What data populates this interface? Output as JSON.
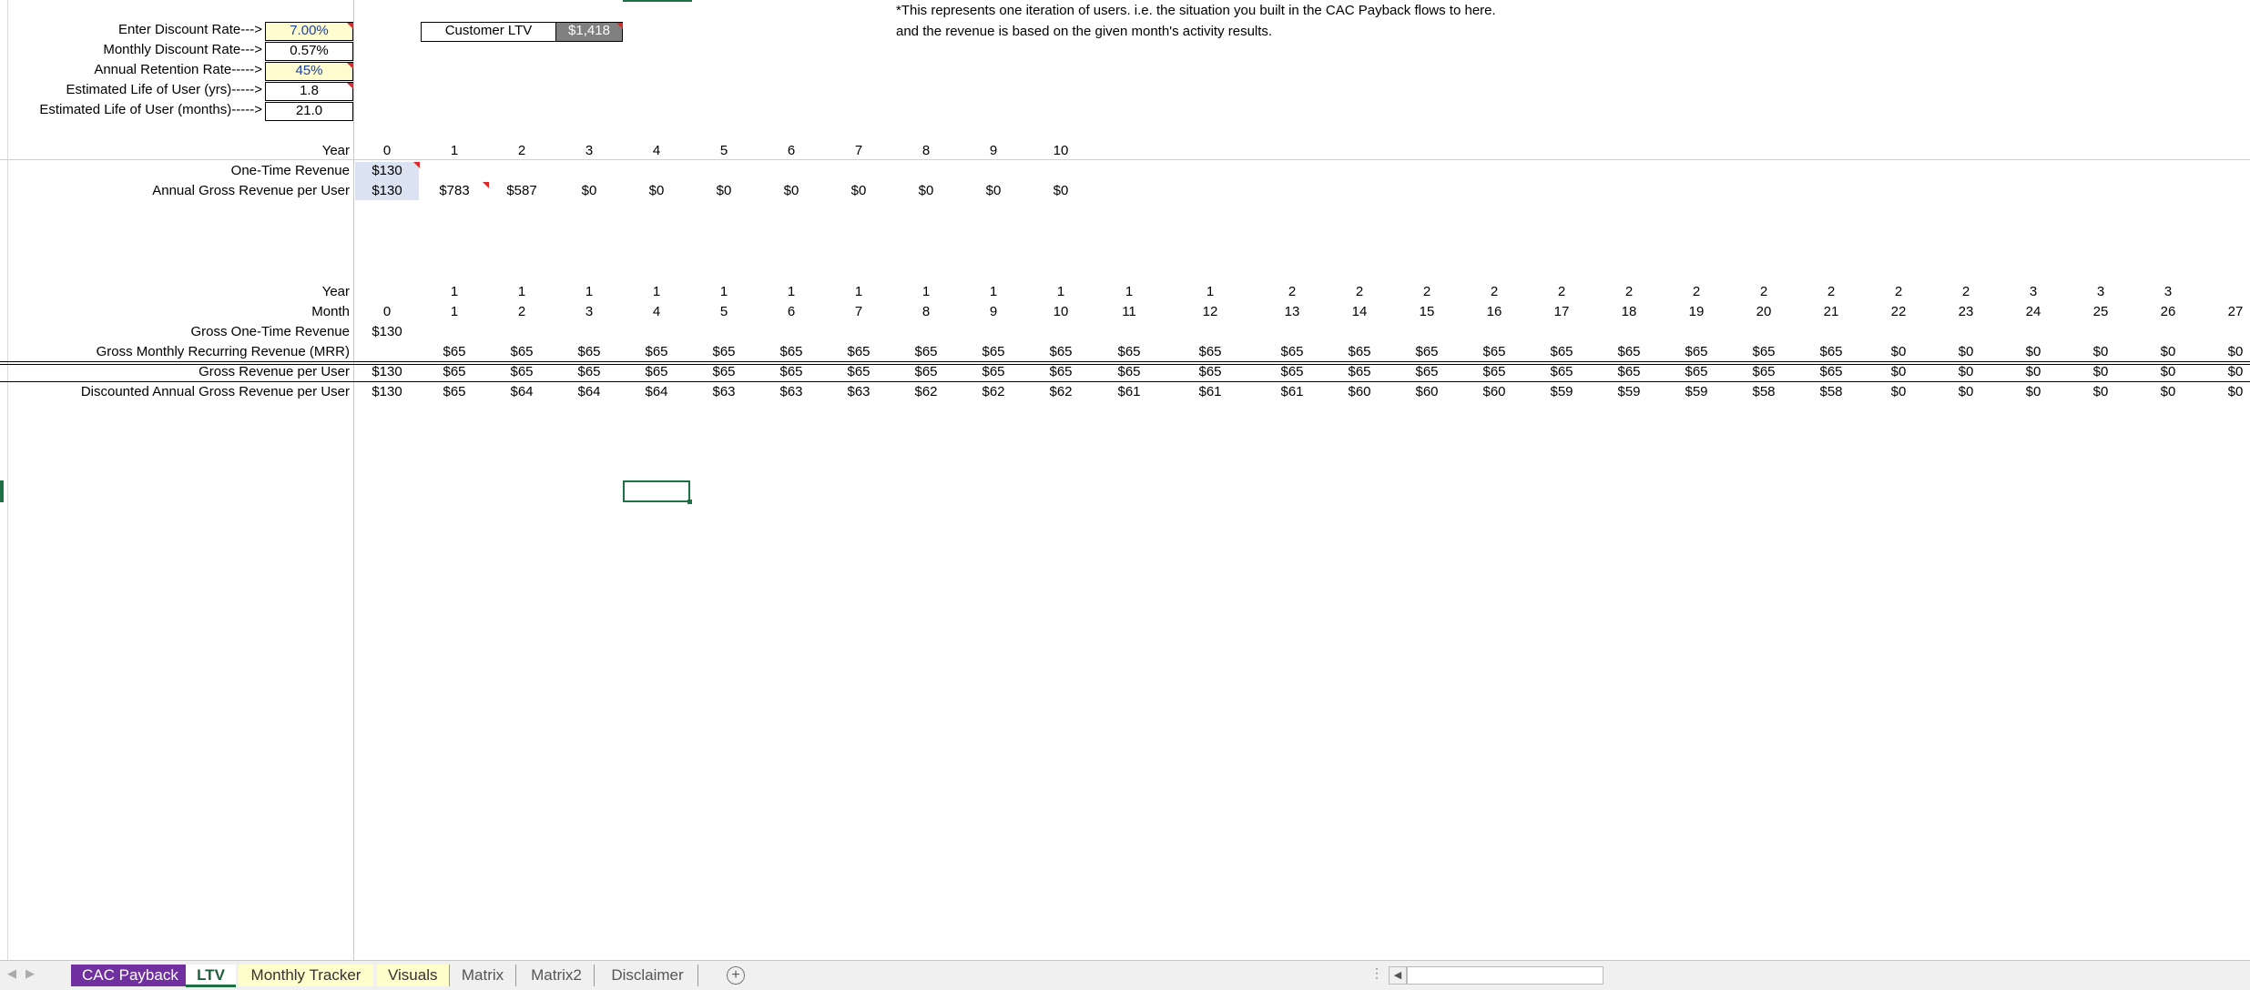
{
  "inputs": [
    {
      "label": "Enter Discount Rate--->",
      "value": "7.00%",
      "style": "yellow"
    },
    {
      "label": "Monthly Discount Rate--->",
      "value": "0.57%",
      "style": "plain"
    },
    {
      "label": "Annual Retention Rate----->",
      "value": "45%",
      "style": "yellow"
    },
    {
      "label": "Estimated Life of User (yrs)----->",
      "value": "1.8",
      "style": "plain"
    },
    {
      "label": "Estimated Life of User (months)----->",
      "value": "21.0",
      "style": "plain"
    }
  ],
  "ltv": {
    "label": "Customer LTV",
    "value": "$1,418"
  },
  "note": {
    "line1": "*This represents one iteration of users. i.e. the situation you built in the CAC Payback flows to here.",
    "line2": "and the revenue is based on the given month's activity results."
  },
  "annual": {
    "year_label": "Year",
    "years": [
      "0",
      "1",
      "2",
      "3",
      "4",
      "5",
      "6",
      "7",
      "8",
      "9",
      "10"
    ],
    "rows": [
      {
        "label": "One-Time Revenue",
        "values": [
          "$130"
        ]
      },
      {
        "label": "Annual Gross Revenue per User",
        "values": [
          "$130",
          "$783",
          "$587",
          "$0",
          "$0",
          "$0",
          "$0",
          "$0",
          "$0",
          "$0",
          "$0"
        ]
      }
    ]
  },
  "monthly": {
    "year_label": "Year",
    "month_label": "Month",
    "years": [
      "",
      "1",
      "1",
      "1",
      "1",
      "1",
      "1",
      "1",
      "1",
      "1",
      "1",
      "1",
      "1",
      "2",
      "2",
      "2",
      "2",
      "2",
      "2",
      "2",
      "2",
      "2",
      "2",
      "2",
      "3",
      "3",
      "3"
    ],
    "months": [
      "0",
      "1",
      "2",
      "3",
      "4",
      "5",
      "6",
      "7",
      "8",
      "9",
      "10",
      "11",
      "12",
      "13",
      "14",
      "15",
      "16",
      "17",
      "18",
      "19",
      "20",
      "21",
      "22",
      "23",
      "24",
      "25",
      "26",
      "27"
    ],
    "rows": [
      {
        "label": "Gross One-Time Revenue",
        "values": [
          "$130"
        ]
      },
      {
        "label": "Gross Monthly Recurring Revenue (MRR)",
        "values": [
          "",
          "$65",
          "$65",
          "$65",
          "$65",
          "$65",
          "$65",
          "$65",
          "$65",
          "$65",
          "$65",
          "$65",
          "$65",
          "$65",
          "$65",
          "$65",
          "$65",
          "$65",
          "$65",
          "$65",
          "$65",
          "$65",
          "$0",
          "$0",
          "$0",
          "$0",
          "$0",
          "$0"
        ]
      },
      {
        "label": "Gross Revenue per User",
        "values": [
          "$130",
          "$65",
          "$65",
          "$65",
          "$65",
          "$65",
          "$65",
          "$65",
          "$65",
          "$65",
          "$65",
          "$65",
          "$65",
          "$65",
          "$65",
          "$65",
          "$65",
          "$65",
          "$65",
          "$65",
          "$65",
          "$65",
          "$0",
          "$0",
          "$0",
          "$0",
          "$0",
          "$0"
        ]
      },
      {
        "label": "Discounted Annual Gross Revenue per User",
        "values": [
          "$130",
          "$65",
          "$64",
          "$64",
          "$64",
          "$63",
          "$63",
          "$63",
          "$62",
          "$62",
          "$62",
          "$61",
          "$61",
          "$61",
          "$60",
          "$60",
          "$60",
          "$59",
          "$59",
          "$59",
          "$58",
          "$58",
          "$0",
          "$0",
          "$0",
          "$0",
          "$0",
          "$0"
        ]
      }
    ]
  },
  "tabs": [
    {
      "label": "CAC Payback",
      "bg": "#7030a0",
      "fg": "#ffffff"
    },
    {
      "label": "LTV",
      "bg": "#ffffff",
      "fg": "#1e5e3a"
    },
    {
      "label": "Monthly Tracker",
      "bg": "#ffffcc",
      "fg": "#333333"
    },
    {
      "label": "Visuals",
      "bg": "#ffffcc",
      "fg": "#333333"
    },
    {
      "label": "Matrix",
      "bg": "#f0f0f0",
      "fg": "#555555"
    },
    {
      "label": "Matrix2",
      "bg": "#f0f0f0",
      "fg": "#555555"
    },
    {
      "label": "Disclaimer",
      "bg": "#f0f0f0",
      "fg": "#555555"
    }
  ]
}
